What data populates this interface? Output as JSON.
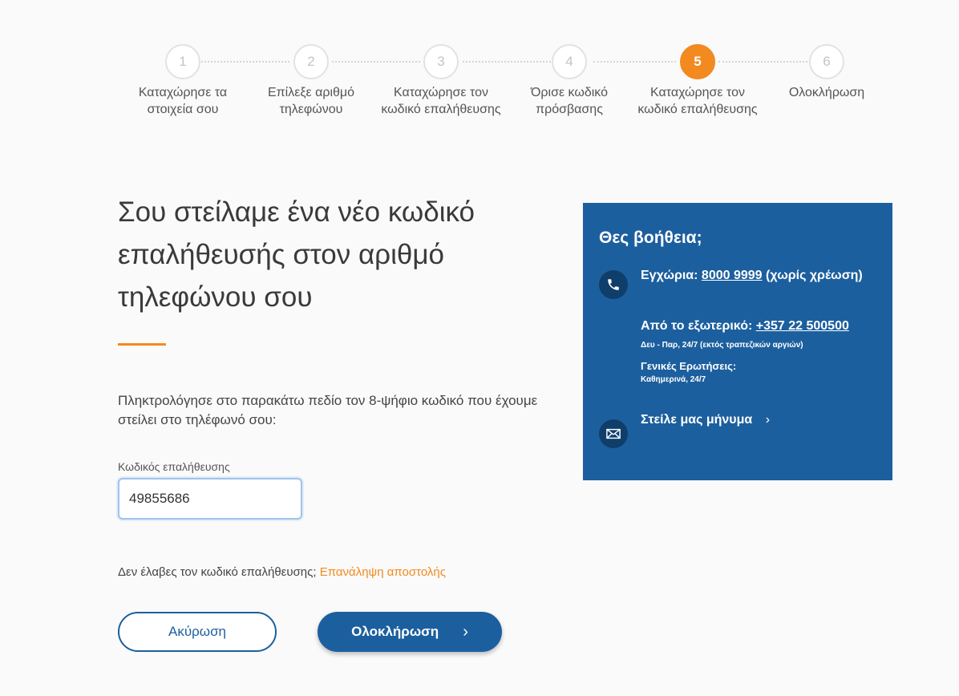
{
  "stepper": {
    "active_index": 4,
    "steps": [
      {
        "number": "1",
        "label": "Καταχώρησε τα στοιχεία σου"
      },
      {
        "number": "2",
        "label": "Επίλεξε αριθμό τηλεφώνου"
      },
      {
        "number": "3",
        "label": "Καταχώρησε τον κωδικό επαλήθευσης"
      },
      {
        "number": "4",
        "label": "Όρισε κωδικό πρόσβασης"
      },
      {
        "number": "5",
        "label": "Καταχώρησε τον κωδικό επαλήθευσης"
      },
      {
        "number": "6",
        "label": "Ολοκλήρωση"
      }
    ]
  },
  "main": {
    "heading": "Σου στείλαμε ένα νέο κωδικό επαλήθευσής στον αριθμό τηλεφώνου σου",
    "instructions": "Πληκτρολόγησε στο παρακάτω πεδίο τον 8-ψήφιο κωδικό που έχουμε στείλει στο τηλέφωνό σου:",
    "code_label": "Κωδικός επαλήθευσης",
    "code_value": "49855686",
    "resend_prompt": "Δεν έλαβες τον κωδικό επαλήθευσης;",
    "resend_link": "Επανάληψη αποστολής",
    "cancel_label": "Ακύρωση",
    "finish_label": "Ολοκλήρωση",
    "finish_chevron": "›"
  },
  "help": {
    "title": "Θες βοήθεια;",
    "local_prefix": "Εγχώρια:",
    "local_number": "8000 9999",
    "local_suffix": "(χωρίς χρέωση)",
    "abroad_prefix": "Από το εξωτερικό:",
    "abroad_number": "+357 22 500500",
    "abroad_hours": "Δευ - Παρ, 24/7 (εκτός τραπεζικών αργιών)",
    "general_label": "Γενικές Ερωτήσεις:",
    "general_hours": "Καθημερινά, 24/7",
    "message_label": "Στείλε μας μήνυμα",
    "message_chevron": "›"
  },
  "colors": {
    "accent": "#f28a1f",
    "primary": "#1c5f9e",
    "background": "#fafafa"
  }
}
